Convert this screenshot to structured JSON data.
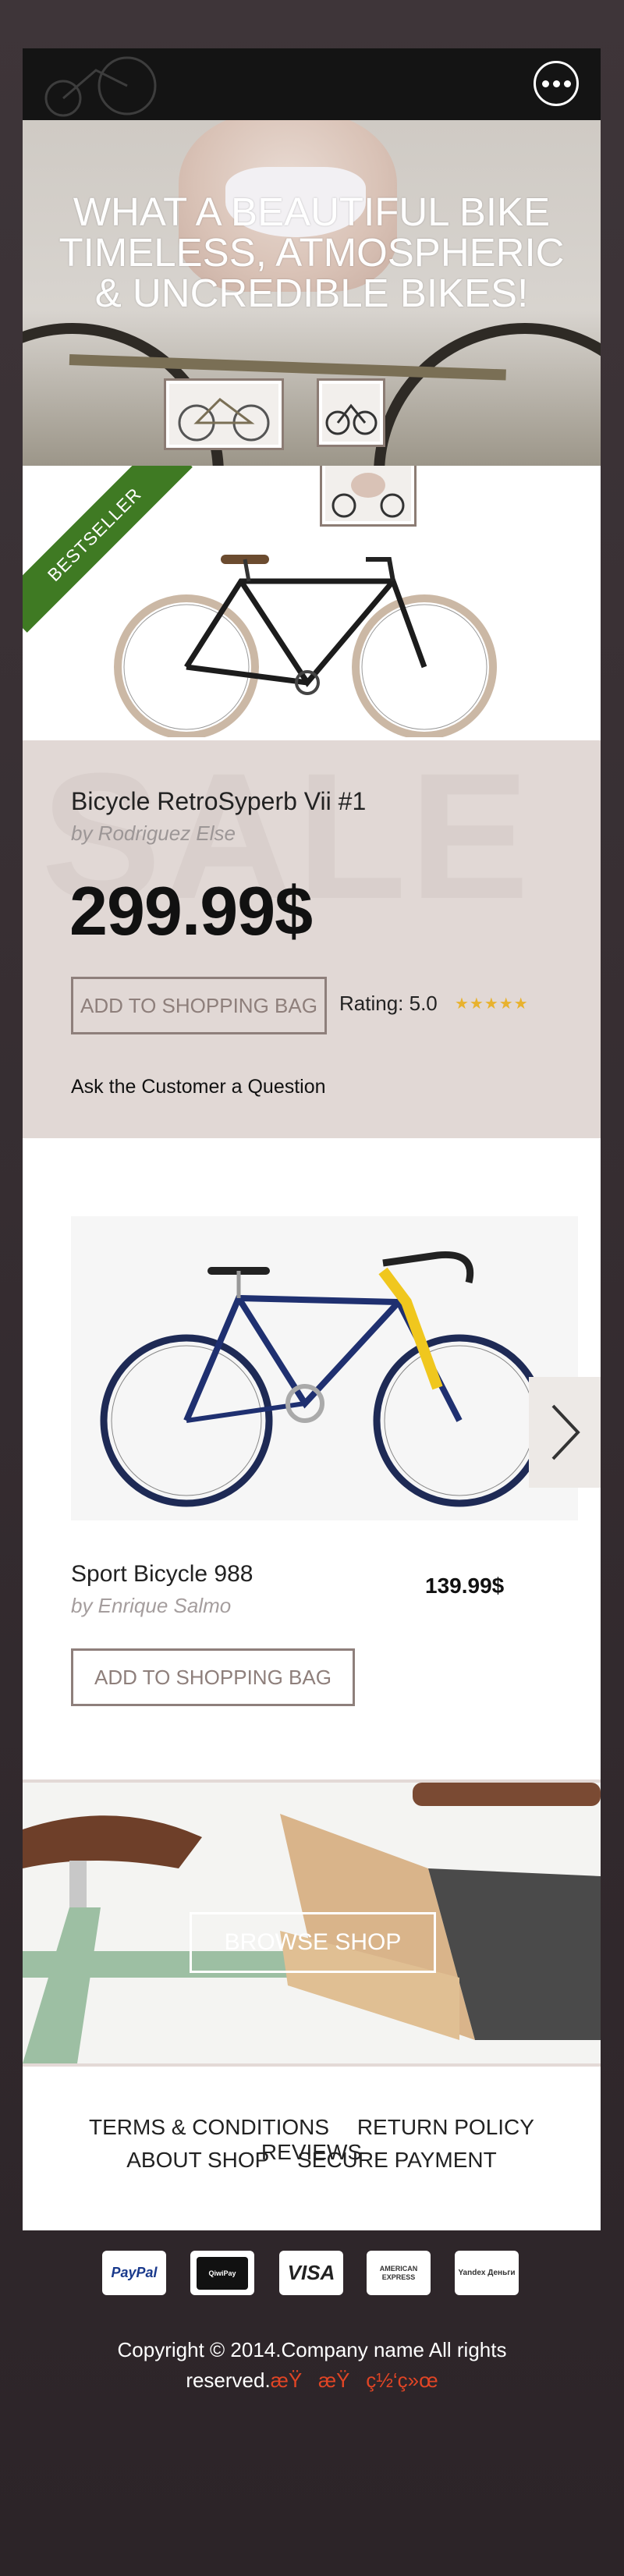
{
  "header": {
    "menu_icon": "more-dots-icon"
  },
  "hero": {
    "lines": [
      "WHAT A BEAUTIFUL BIKE",
      "TIMELESS, ATMOSPHERIC",
      "& UNCREDIBLE BIKES!"
    ]
  },
  "product1": {
    "badge": "BESTSELLER",
    "sale_watermark": "SALE",
    "title": "Bicycle RetroSyperb Vii #1",
    "author": "by Rodriguez Else",
    "price": "299.99$",
    "add_button": "ADD TO SHOPPING BAG",
    "rating_label": "Rating: 5.0",
    "stars": "★★★★★",
    "ask": "Ask the Customer a Question"
  },
  "product2": {
    "title": "Sport Bicycle 988",
    "author": "by Enrique Salmo",
    "price": "139.99$",
    "add_button": "ADD TO SHOPPING BAG",
    "next_icon": "chevron-right-icon"
  },
  "banner": {
    "button": "BROWSE SHOP"
  },
  "footer": {
    "links_row1": [
      "TERMS & CONDITIONS",
      "RETURN POLICY",
      "REVIEWS"
    ],
    "links_row2": [
      "ABOUT SHOP",
      "SECURE PAYMENT"
    ],
    "payments": [
      "PayPal",
      "QiwiPay",
      "VISA",
      "AMERICAN EXPRESS",
      "Yandex Деньги"
    ],
    "copyright_line1": "Copyright © 2014.Company name All rights",
    "copyright_line2": "reserved.",
    "copyright_garbled": "æŸæŸç½‘ç»œ"
  },
  "colors": {
    "accent_green": "#3f7a23",
    "panel": "#e1d8d5",
    "button_border": "#8e7f7b",
    "star": "#e8b22e"
  }
}
